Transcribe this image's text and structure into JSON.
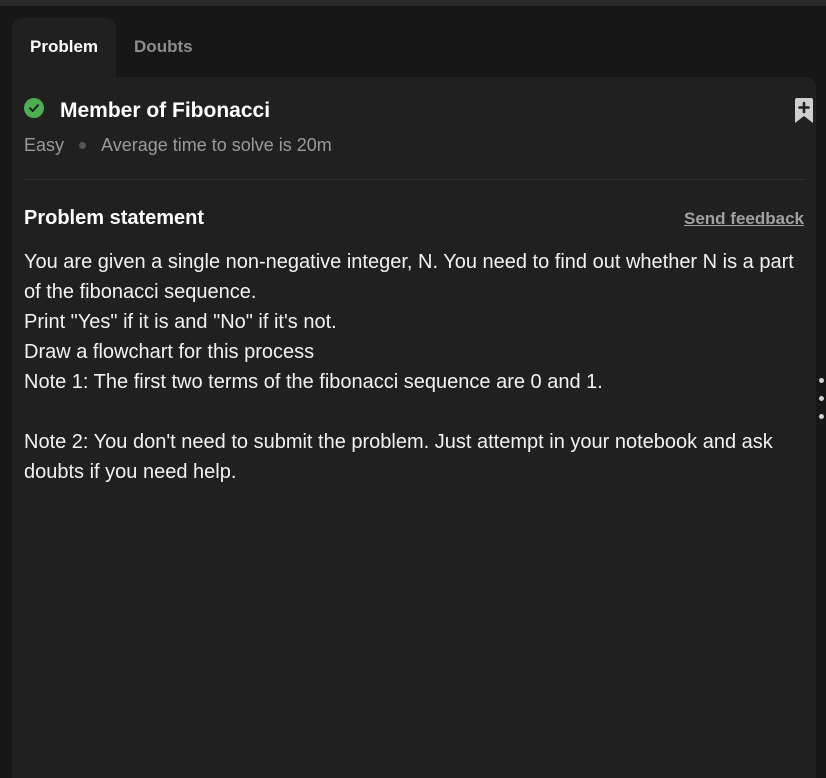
{
  "tabs": [
    {
      "label": "Problem",
      "active": true
    },
    {
      "label": "Doubts",
      "active": false
    }
  ],
  "problem": {
    "title": "Member of Fibonacci",
    "status": "solved",
    "difficulty": "Easy",
    "avg_time": "Average time to solve is 20m"
  },
  "statement": {
    "heading": "Problem statement",
    "feedback_label": "Send feedback",
    "lines": [
      "You are given a single non-negative integer, N. You need to find out whether N is a part of the fibonacci sequence.",
      "Print \"Yes\" if it is and \"No\" if it's not.",
      "Draw a flowchart for this process",
      "Note 1: The first two terms of the fibonacci sequence are 0 and 1.",
      "",
      "Note 2: You don't need to submit the problem. Just attempt in your notebook and ask doubts if you need help."
    ]
  },
  "icons": {
    "status": "check-circle-icon",
    "bookmark": "bookmark-add-icon",
    "handle": "drag-handle-icon"
  },
  "colors": {
    "accent_green": "#4caf50",
    "panel_bg": "#202020",
    "page_bg": "#171717",
    "muted_text": "#9a9a9a"
  }
}
